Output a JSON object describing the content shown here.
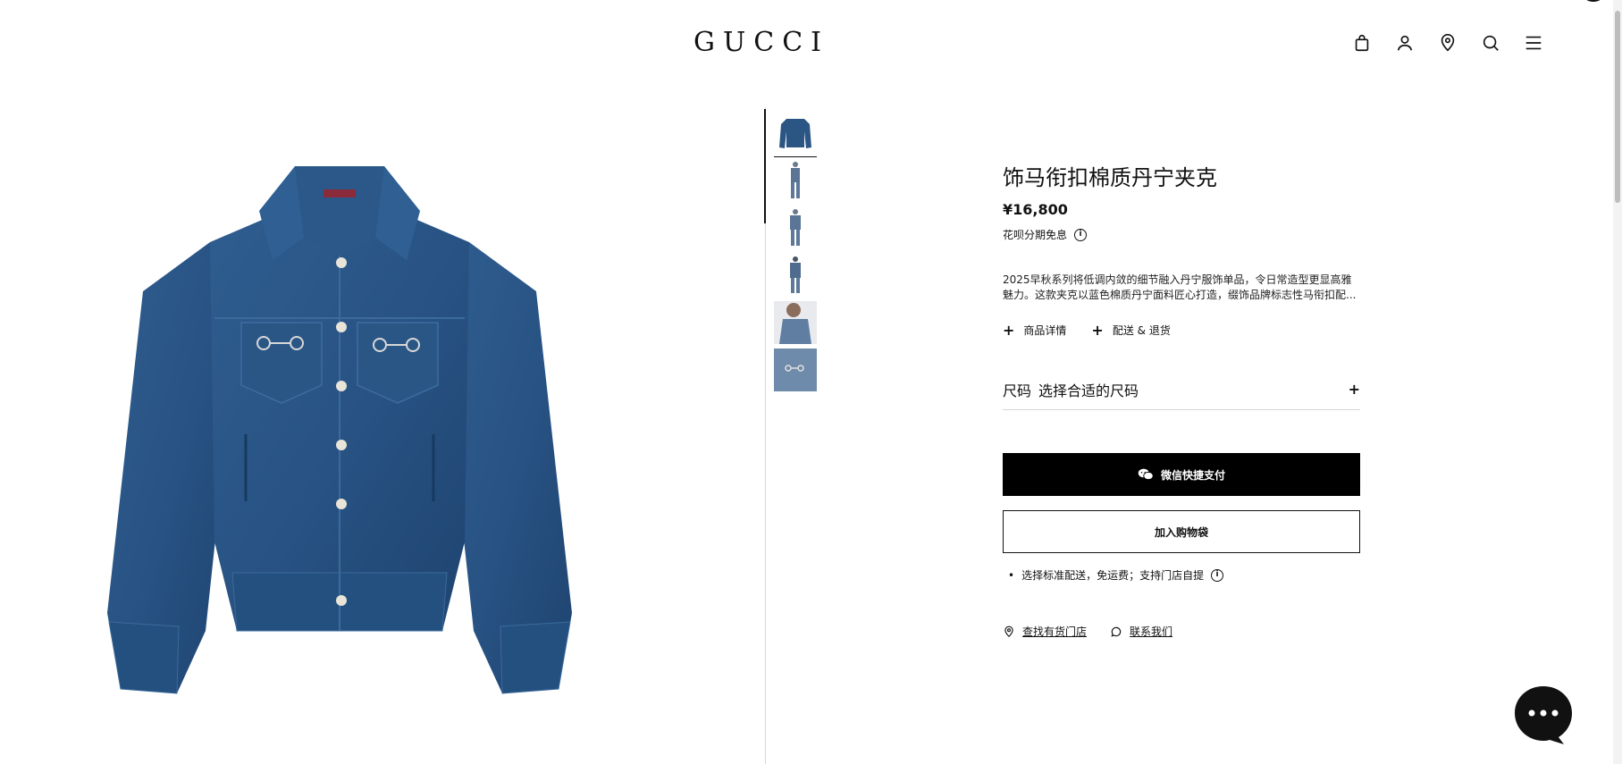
{
  "header": {
    "logo": "GUCCI",
    "icons": [
      "shopping-bag-icon",
      "user-icon",
      "location-pin-icon",
      "search-icon",
      "menu-icon"
    ]
  },
  "product": {
    "title": "饰马衔扣棉质丹宁夹克",
    "price": "¥16,800",
    "installment": "花呗分期免息",
    "description_line1": "2025早秋系列将低调内敛的细节融入丹宁服饰单品，令日常造型更显高雅",
    "description_line2": "魅力。这款夹克以蓝色棉质丹宁面料匠心打造，缀饰品牌标志性马衔扣配...",
    "details_label": "商品详情",
    "shipping_returns_label": "配送 & 退货",
    "size_label": "尺码",
    "size_placeholder": "选择合适的尺码",
    "wechat_pay_label": "微信快捷支付",
    "add_to_bag_label": "加入购物袋",
    "shipping_note": "选择标准配送，免运费；支持门店自提",
    "find_store_label": "查找有货门店",
    "contact_label": "联系我们"
  },
  "gallery": {
    "thumb_count": 6,
    "active_index": 0
  },
  "colors": {
    "denim": "#2b5684",
    "denim_dark": "#1f4268",
    "accent_black": "#000000"
  }
}
